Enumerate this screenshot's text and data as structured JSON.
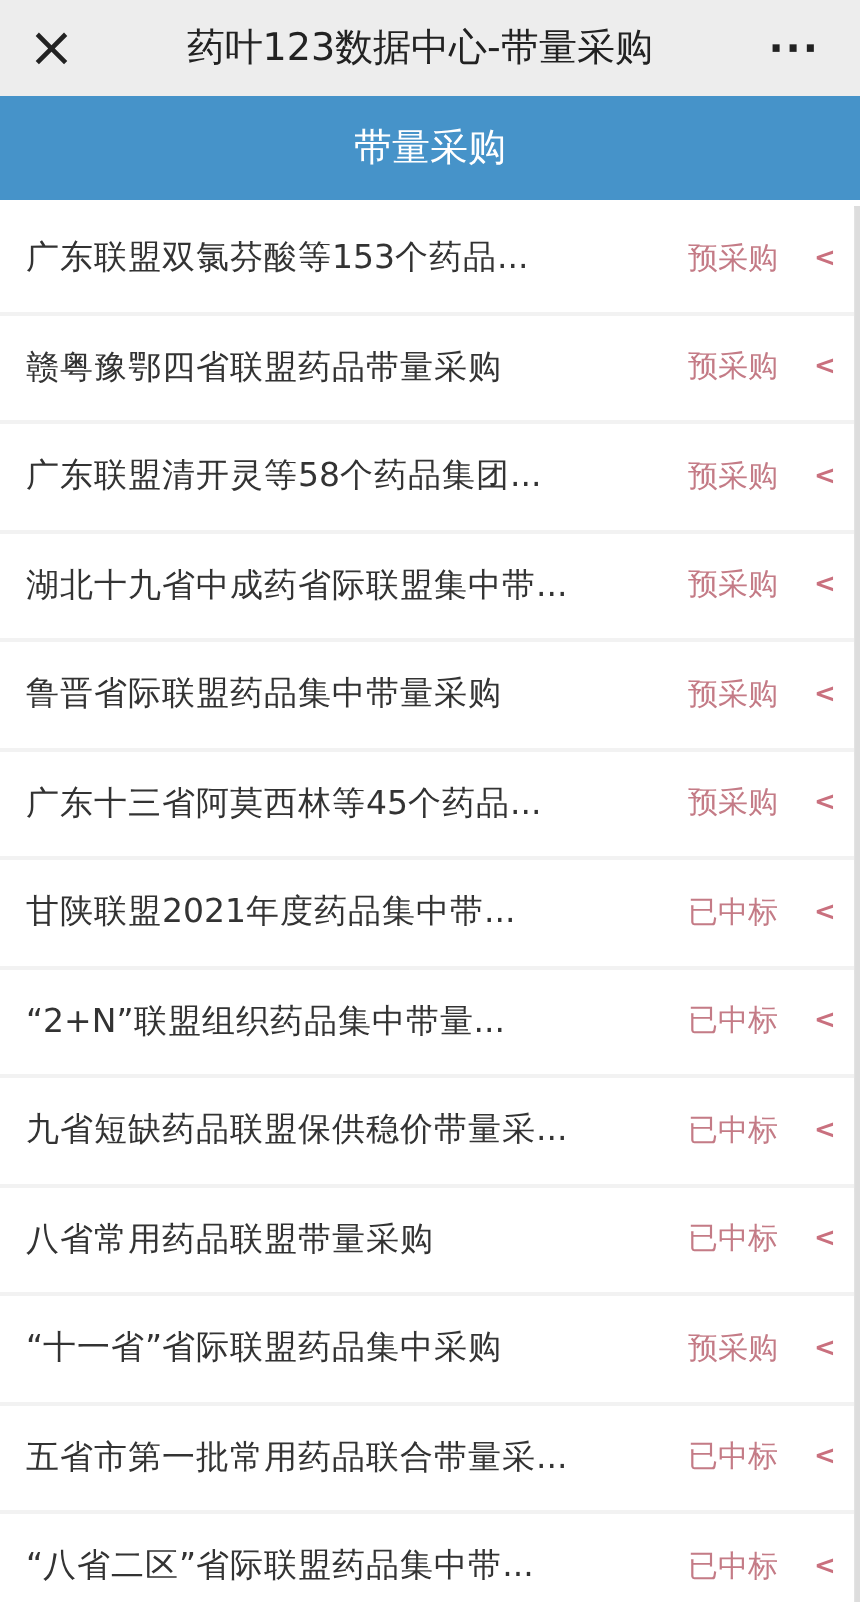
{
  "top_bar": {
    "close": "×",
    "title": "药叶123数据中心-带量采购",
    "more": "···"
  },
  "header": {
    "title": "带量采购"
  },
  "rows": [
    {
      "title": "广东联盟双氯芬酸等153个药品...",
      "status": "预采购",
      "arrow": "<"
    },
    {
      "title": "赣粤豫鄂四省联盟药品带量采购",
      "status": "预采购",
      "arrow": "<"
    },
    {
      "title": "广东联盟清开灵等58个药品集团...",
      "status": "预采购",
      "arrow": "<"
    },
    {
      "title": "湖北十九省中成药省际联盟集中带...",
      "status": "预采购",
      "arrow": "<"
    },
    {
      "title": "鲁晋省际联盟药品集中带量采购",
      "status": "预采购",
      "arrow": "<"
    },
    {
      "title": "广东十三省阿莫西林等45个药品...",
      "status": "预采购",
      "arrow": "<"
    },
    {
      "title": "甘陕联盟2021年度药品集中带...",
      "status": "已中标",
      "arrow": "<"
    },
    {
      "title": "“2+N”联盟组织药品集中带量...",
      "status": "已中标",
      "arrow": "<"
    },
    {
      "title": "九省短缺药品联盟保供稳价带量采...",
      "status": "已中标",
      "arrow": "<"
    },
    {
      "title": "八省常用药品联盟带量采购",
      "status": "已中标",
      "arrow": "<"
    },
    {
      "title": "“十一省”省际联盟药品集中采购",
      "status": "预采购",
      "arrow": "<"
    },
    {
      "title": "五省市第一批常用药品联合带量采...",
      "status": "已中标",
      "arrow": "<"
    },
    {
      "title": "“八省二区”省际联盟药品集中带...",
      "status": "已中标",
      "arrow": "<"
    }
  ]
}
